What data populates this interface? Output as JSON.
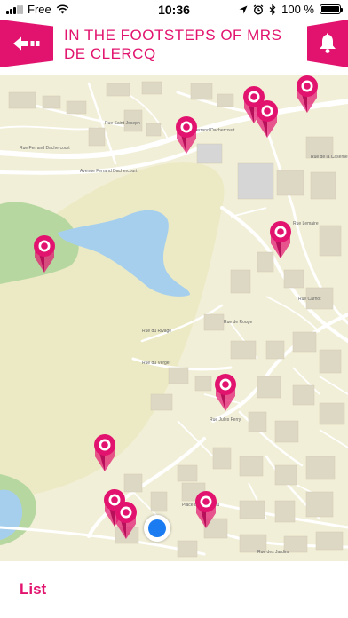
{
  "status_bar": {
    "carrier": "Free",
    "time": "10:36",
    "battery": "100 %",
    "battery_level": 1.0
  },
  "header": {
    "title": "IN THE FOOTSTEPS OF MRS DE CLERCQ",
    "back_icon": "back-arrow-icon",
    "notify_icon": "bell-icon"
  },
  "map": {
    "streets": [
      "Rue Saint-Joseph",
      "Rue Ferrand Dachercourt",
      "Avenue Ferrand Dachercourt",
      "Avenue Ferrand Dachercourt",
      "Rue de la Caserne",
      "Rue Lemaire",
      "Rue Carnot",
      "Rue du Rivage",
      "Rue du Verger",
      "Rue de Rouge",
      "Rue Jules Ferry",
      "Rue des Jardins",
      "Place de Bois Dieu"
    ],
    "pin_count": 11
  },
  "bottom": {
    "list_label": "List"
  },
  "colors": {
    "accent": "#e2136e",
    "map_background": "#f2efd8",
    "park": "#b7d7a0",
    "water": "#a6cfee",
    "location": "#1a7cf0"
  }
}
